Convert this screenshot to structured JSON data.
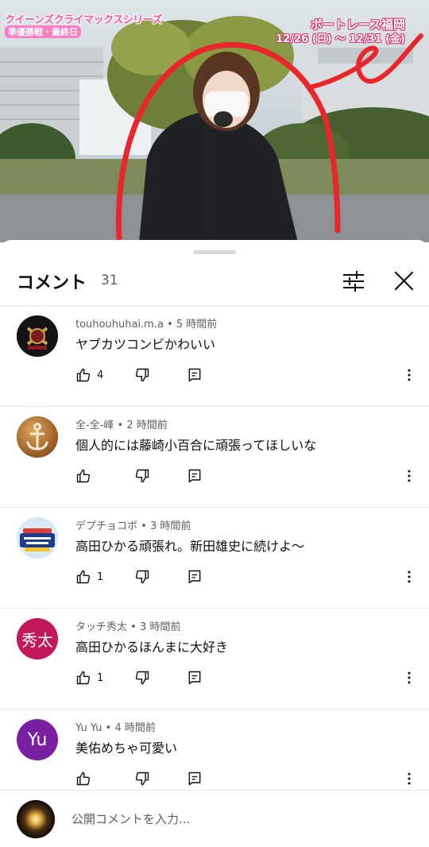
{
  "video": {
    "overlay_title": "クイーンズクライマックスシリーズ",
    "overlay_subtitle": "準優勝戦・最終日",
    "overlay_venue": "ボートレース福岡",
    "overlay_dates": "12/26 (日) ～ 12/31 (金)"
  },
  "panel": {
    "title": "コメント",
    "count": "31",
    "sort_icon": "sliders-icon",
    "close_icon": "close-icon"
  },
  "comments": [
    {
      "author": "touhouhuhai.m.a",
      "time": "5 時間前",
      "text": "ヤブカツコンビかわいい",
      "likes": "4",
      "avatar": "emblem-avatar",
      "avatar_text": ""
    },
    {
      "author": "全-全-峰",
      "time": "2 時間前",
      "text": "個人的には藤崎小百合に頑張ってほしいな",
      "likes": "",
      "avatar": "anchor-avatar",
      "avatar_text": ""
    },
    {
      "author": "デプチョコボ",
      "time": "3 時間前",
      "text": "高田ひかる頑張れ。新田雄史に続けよ～",
      "likes": "1",
      "avatar": "nintendo-world-avatar",
      "avatar_text": ""
    },
    {
      "author": "タッチ秀太",
      "time": "3 時間前",
      "text": "高田ひかるほんまに大好き",
      "likes": "1",
      "avatar": "initials-avatar",
      "avatar_text": "秀太",
      "avatar_color": "#c2185b"
    },
    {
      "author": "Yu Yu",
      "time": "4 時間前",
      "text": "美佑めちゃ可愛い",
      "likes": "",
      "avatar": "initials-avatar",
      "avatar_text": "Yu",
      "avatar_color": "#7b1fa2"
    }
  ],
  "input": {
    "placeholder": "公開コメントを入力..."
  },
  "colors": {
    "text_primary": "#0f0f0f",
    "text_secondary": "#606060",
    "divider": "#e5e5e5",
    "drawn_annotation": "#e8262b"
  }
}
